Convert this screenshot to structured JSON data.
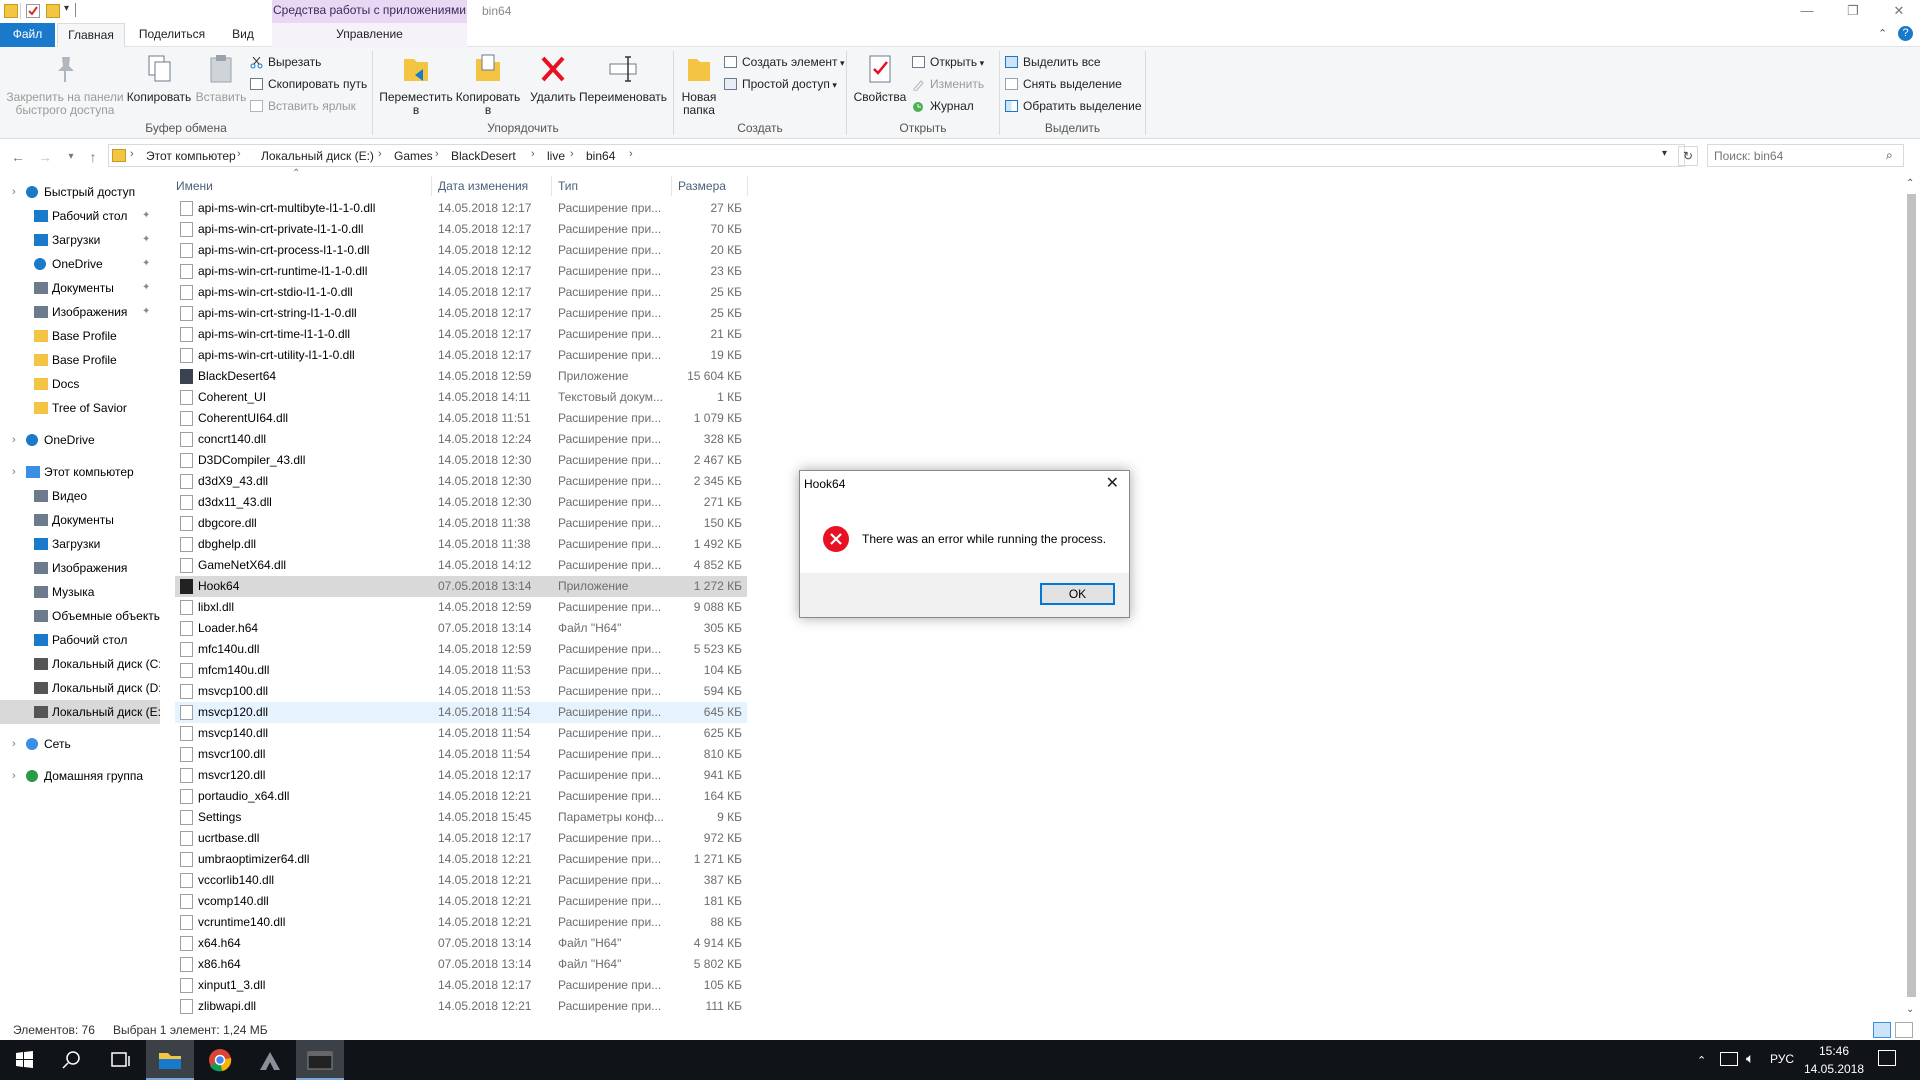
{
  "window": {
    "title": "bin64",
    "context_tab": "Средства работы с приложениями",
    "controls": {
      "minimize": "—",
      "maximize": "❐",
      "close": "✕"
    }
  },
  "ribbon_tabs": [
    {
      "label": "Файл"
    },
    {
      "label": "Главная"
    },
    {
      "label": "Поделиться"
    },
    {
      "label": "Вид"
    },
    {
      "label": "Управление"
    }
  ],
  "ribbon": {
    "clipboard": {
      "pin_label": "Закрепить на панели быстрого доступа",
      "copy_label": "Копировать",
      "paste_label": "Вставить",
      "cut": "Вырезать",
      "copy_path": "Скопировать путь",
      "paste_shortcut": "Вставить ярлык",
      "group": "Буфер обмена"
    },
    "organize": {
      "move_to": "Переместить в",
      "copy_to": "Копировать в",
      "delete": "Удалить",
      "rename": "Переименовать",
      "group": "Упорядочить"
    },
    "create": {
      "new_folder": "Новая папка",
      "new_item": "Создать элемент",
      "easy_access": "Простой доступ",
      "group": "Создать"
    },
    "open": {
      "properties": "Свойства",
      "open": "Открыть",
      "edit": "Изменить",
      "history": "Журнал",
      "group": "Открыть"
    },
    "select": {
      "select_all": "Выделить все",
      "select_none": "Снять выделение",
      "invert": "Обратить выделение",
      "group": "Выделить"
    }
  },
  "address": {
    "crumbs": [
      "Этот компьютер",
      "Локальный диск (E:)",
      "Games",
      "BlackDesert",
      "live",
      "bin64"
    ],
    "search_placeholder": "Поиск: bin64"
  },
  "nav": {
    "items": [
      {
        "label": "Быстрый доступ",
        "icon": "star-icon"
      },
      {
        "label": "Рабочий стол",
        "icon": "desktop-icon",
        "pinned": true
      },
      {
        "label": "Загрузки",
        "icon": "download-icon",
        "pinned": true
      },
      {
        "label": "OneDrive",
        "icon": "cloud-icon",
        "pinned": true
      },
      {
        "label": "Документы",
        "icon": "documents-icon",
        "pinned": true
      },
      {
        "label": "Изображения",
        "icon": "pictures-icon",
        "pinned": true
      },
      {
        "label": "Base Profile",
        "icon": "folder-icon"
      },
      {
        "label": "Base Profile",
        "icon": "folder-icon"
      },
      {
        "label": "Docs",
        "icon": "folder-icon"
      },
      {
        "label": "Tree of Savior",
        "icon": "folder-icon"
      },
      {
        "label": "OneDrive",
        "icon": "cloud-icon"
      },
      {
        "label": "Этот компьютер",
        "icon": "computer-icon"
      },
      {
        "label": "Видео",
        "icon": "video-icon"
      },
      {
        "label": "Документы",
        "icon": "documents-icon"
      },
      {
        "label": "Загрузки",
        "icon": "download-icon"
      },
      {
        "label": "Изображения",
        "icon": "pictures-icon"
      },
      {
        "label": "Музыка",
        "icon": "music-icon"
      },
      {
        "label": "Объемные объекты",
        "icon": "3d-objects-icon"
      },
      {
        "label": "Рабочий стол",
        "icon": "desktop-icon"
      },
      {
        "label": "Локальный диск (C:)",
        "icon": "drive-icon"
      },
      {
        "label": "Локальный диск (D:)",
        "icon": "drive-icon"
      },
      {
        "label": "Локальный диск (E:)",
        "icon": "drive-icon",
        "selected": true
      },
      {
        "label": "Сеть",
        "icon": "network-icon"
      },
      {
        "label": "Домашняя группа",
        "icon": "homegroup-icon"
      }
    ]
  },
  "columns": [
    "Имени",
    "Дата изменения",
    "Тип",
    "Размера"
  ],
  "files": [
    {
      "name": "api-ms-win-crt-multibyte-l1-1-0.dll",
      "date": "14.05.2018 12:17",
      "type": "Расширение при...",
      "size": "27 КБ"
    },
    {
      "name": "api-ms-win-crt-private-l1-1-0.dll",
      "date": "14.05.2018 12:17",
      "type": "Расширение при...",
      "size": "70 КБ"
    },
    {
      "name": "api-ms-win-crt-process-l1-1-0.dll",
      "date": "14.05.2018 12:12",
      "type": "Расширение при...",
      "size": "20 КБ"
    },
    {
      "name": "api-ms-win-crt-runtime-l1-1-0.dll",
      "date": "14.05.2018 12:17",
      "type": "Расширение при...",
      "size": "23 КБ"
    },
    {
      "name": "api-ms-win-crt-stdio-l1-1-0.dll",
      "date": "14.05.2018 12:17",
      "type": "Расширение при...",
      "size": "25 КБ"
    },
    {
      "name": "api-ms-win-crt-string-l1-1-0.dll",
      "date": "14.05.2018 12:17",
      "type": "Расширение при...",
      "size": "25 КБ"
    },
    {
      "name": "api-ms-win-crt-time-l1-1-0.dll",
      "date": "14.05.2018 12:17",
      "type": "Расширение при...",
      "size": "21 КБ"
    },
    {
      "name": "api-ms-win-crt-utility-l1-1-0.dll",
      "date": "14.05.2018 12:17",
      "type": "Расширение при...",
      "size": "19 КБ"
    },
    {
      "name": "BlackDesert64",
      "date": "14.05.2018 12:59",
      "type": "Приложение",
      "size": "15 604 КБ",
      "kind": "app"
    },
    {
      "name": "Coherent_UI",
      "date": "14.05.2018 14:11",
      "type": "Текстовый докум...",
      "size": "1 КБ"
    },
    {
      "name": "CoherentUI64.dll",
      "date": "14.05.2018 11:51",
      "type": "Расширение при...",
      "size": "1 079 КБ"
    },
    {
      "name": "concrt140.dll",
      "date": "14.05.2018 12:24",
      "type": "Расширение при...",
      "size": "328 КБ"
    },
    {
      "name": "D3DCompiler_43.dll",
      "date": "14.05.2018 12:30",
      "type": "Расширение при...",
      "size": "2 467 КБ"
    },
    {
      "name": "d3dX9_43.dll",
      "date": "14.05.2018 12:30",
      "type": "Расширение при...",
      "size": "2 345 КБ"
    },
    {
      "name": "d3dx11_43.dll",
      "date": "14.05.2018 12:30",
      "type": "Расширение при...",
      "size": "271 КБ"
    },
    {
      "name": "dbgcore.dll",
      "date": "14.05.2018 11:38",
      "type": "Расширение при...",
      "size": "150 КБ"
    },
    {
      "name": "dbghelp.dll",
      "date": "14.05.2018 11:38",
      "type": "Расширение при...",
      "size": "1 492 КБ"
    },
    {
      "name": "GameNetX64.dll",
      "date": "14.05.2018 14:12",
      "type": "Расширение при...",
      "size": "4 852 КБ"
    },
    {
      "name": "Hook64",
      "date": "07.05.2018 13:14",
      "type": "Приложение",
      "size": "1 272 КБ",
      "kind": "exe",
      "selected": true
    },
    {
      "name": "libxl.dll",
      "date": "14.05.2018 12:59",
      "type": "Расширение при...",
      "size": "9 088 КБ"
    },
    {
      "name": "Loader.h64",
      "date": "07.05.2018 13:14",
      "type": "Файл \"H64\"",
      "size": "305 КБ"
    },
    {
      "name": "mfc140u.dll",
      "date": "14.05.2018 12:59",
      "type": "Расширение при...",
      "size": "5 523 КБ"
    },
    {
      "name": "mfcm140u.dll",
      "date": "14.05.2018 11:53",
      "type": "Расширение при...",
      "size": "104 КБ"
    },
    {
      "name": "msvcp100.dll",
      "date": "14.05.2018 11:53",
      "type": "Расширение при...",
      "size": "594 КБ"
    },
    {
      "name": "msvcp120.dll",
      "date": "14.05.2018 11:54",
      "type": "Расширение при...",
      "size": "645 КБ",
      "hover": true
    },
    {
      "name": "msvcp140.dll",
      "date": "14.05.2018 11:54",
      "type": "Расширение при...",
      "size": "625 КБ"
    },
    {
      "name": "msvcr100.dll",
      "date": "14.05.2018 11:54",
      "type": "Расширение при...",
      "size": "810 КБ"
    },
    {
      "name": "msvcr120.dll",
      "date": "14.05.2018 12:17",
      "type": "Расширение при...",
      "size": "941 КБ"
    },
    {
      "name": "portaudio_x64.dll",
      "date": "14.05.2018 12:21",
      "type": "Расширение при...",
      "size": "164 КБ"
    },
    {
      "name": "Settings",
      "date": "14.05.2018 15:45",
      "type": "Параметры конф...",
      "size": "9 КБ"
    },
    {
      "name": "ucrtbase.dll",
      "date": "14.05.2018 12:17",
      "type": "Расширение при...",
      "size": "972 КБ"
    },
    {
      "name": "umbraoptimizer64.dll",
      "date": "14.05.2018 12:21",
      "type": "Расширение при...",
      "size": "1 271 КБ"
    },
    {
      "name": "vccorlib140.dll",
      "date": "14.05.2018 12:21",
      "type": "Расширение при...",
      "size": "387 КБ"
    },
    {
      "name": "vcomp140.dll",
      "date": "14.05.2018 12:21",
      "type": "Расширение при...",
      "size": "181 КБ"
    },
    {
      "name": "vcruntime140.dll",
      "date": "14.05.2018 12:21",
      "type": "Расширение при...",
      "size": "88 КБ"
    },
    {
      "name": "x64.h64",
      "date": "07.05.2018 13:14",
      "type": "Файл \"H64\"",
      "size": "4 914 КБ"
    },
    {
      "name": "x86.h64",
      "date": "07.05.2018 13:14",
      "type": "Файл \"H64\"",
      "size": "5 802 КБ"
    },
    {
      "name": "xinput1_3.dll",
      "date": "14.05.2018 12:17",
      "type": "Расширение при...",
      "size": "105 КБ"
    },
    {
      "name": "zlibwapi.dll",
      "date": "14.05.2018 12:21",
      "type": "Расширение при...",
      "size": "111 КБ"
    }
  ],
  "status": {
    "count": "Элементов: 76",
    "selection": "Выбран 1 элемент: 1,24 МБ"
  },
  "dialog": {
    "title": "Hook64",
    "message": "There was an error while running the process.",
    "ok": "OK",
    "close": "✕"
  },
  "taskbar": {
    "lang": "РУС",
    "time": "15:46",
    "date": "14.05.2018"
  },
  "colors": {
    "file_tab": "#1979ca",
    "context_tab": "#e9d7f4",
    "selection": "#d9d9d9",
    "error": "#e81123",
    "taskbar": "#101418"
  }
}
